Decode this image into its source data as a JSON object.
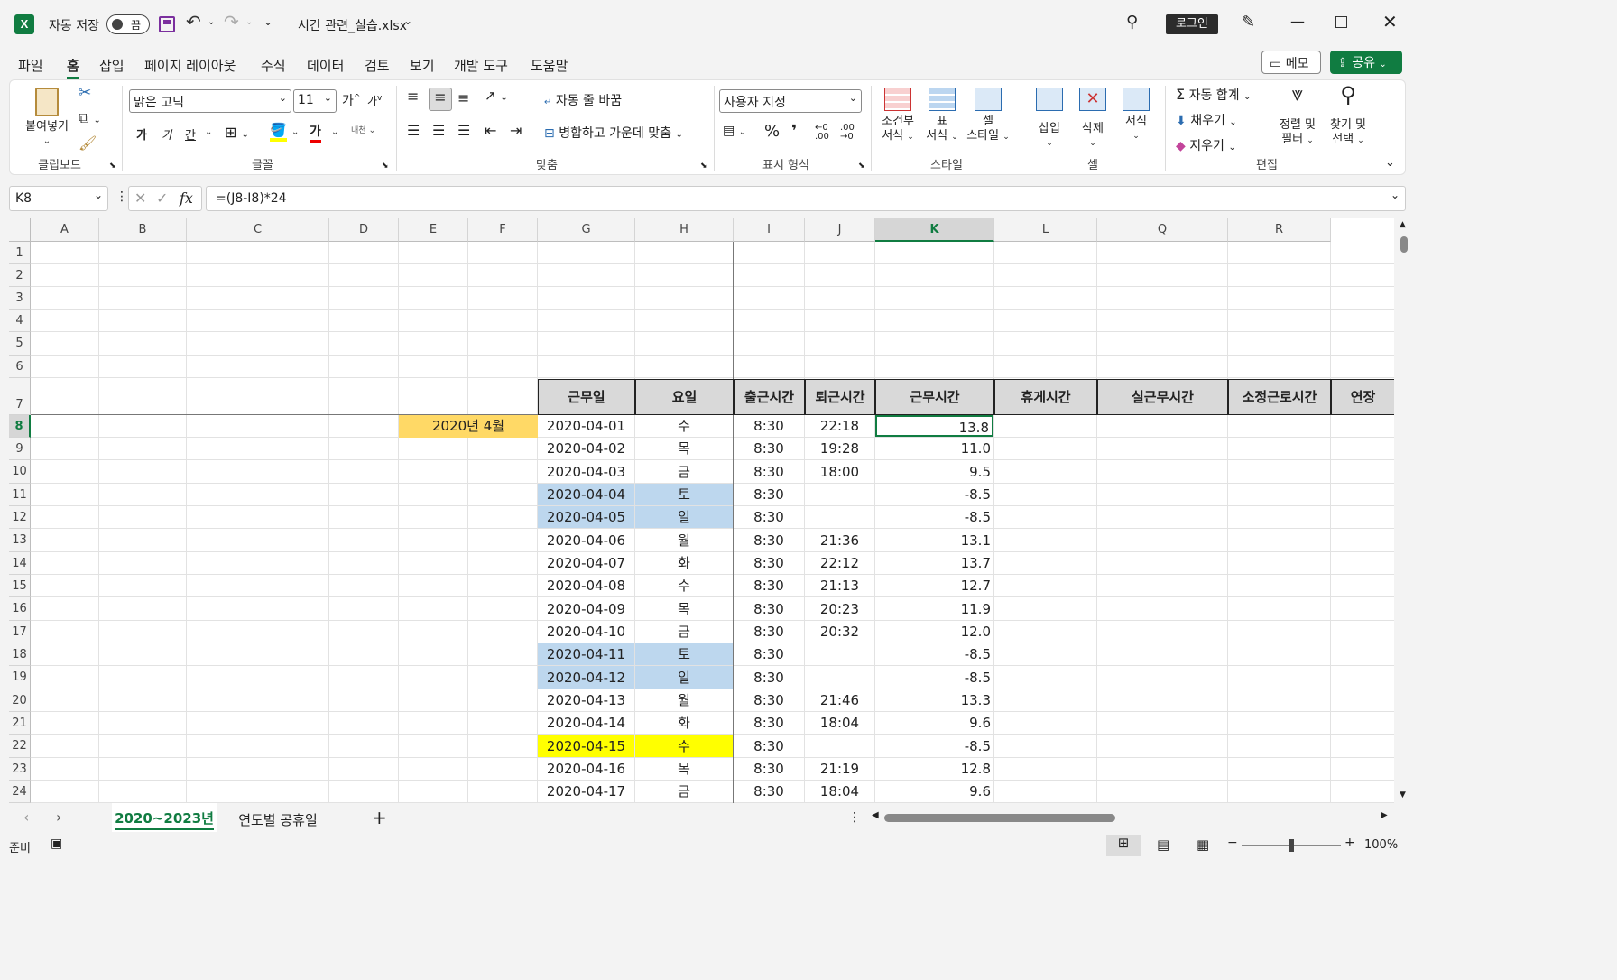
{
  "title": {
    "autosave_label": "자동 저장",
    "autosave_state": "끔",
    "filename": "시간 관련_실습.xlsx",
    "login_label": "로그인"
  },
  "menu": [
    "파일",
    "홈",
    "삽입",
    "페이지 레이아웃",
    "수식",
    "데이터",
    "검토",
    "보기",
    "개발 도구",
    "도움말"
  ],
  "menu_right": {
    "memo": "메모",
    "share": "공유"
  },
  "ribbon": {
    "clipboard": {
      "paste": "붙여넣기",
      "label": "클립보드"
    },
    "font": {
      "name": "맑은 고딕",
      "size": "11",
      "label": "글꼴",
      "bold": "가",
      "italic": "가",
      "underline": "간",
      "grow": "가",
      "shrink": "가"
    },
    "align": {
      "wrap": "자동 줄 바꿈",
      "merge": "병합하고 가운데 맞춤",
      "label": "맞춤"
    },
    "number": {
      "format": "사용자 지정",
      "label": "표시 형식",
      "percent": "%",
      "comma": "❜"
    },
    "styles": {
      "conditional": [
        "조건부",
        "서식"
      ],
      "table": [
        "표",
        "서식"
      ],
      "cell": [
        "셀",
        "스타일"
      ],
      "label": "스타일"
    },
    "cells": {
      "insert": "삽입",
      "delete": "삭제",
      "format": "서식",
      "label": "셀"
    },
    "edit": {
      "autosum": "자동 합계",
      "fill": "채우기",
      "clear": "지우기",
      "sort": [
        "정렬 및",
        "필터"
      ],
      "find": [
        "찾기 및",
        "선택"
      ],
      "label": "편집"
    }
  },
  "formula": {
    "namebox": "K8",
    "fx": "fx",
    "content": "=(J8-I8)*24"
  },
  "columns": [
    "A",
    "B",
    "C",
    "D",
    "E",
    "F",
    "G",
    "H",
    "I",
    "J",
    "K",
    "L",
    "Q",
    "R"
  ],
  "rows": [
    "1",
    "2",
    "3",
    "4",
    "5",
    "6",
    "7",
    "8",
    "9",
    "10",
    "11",
    "12",
    "13",
    "14",
    "15",
    "16",
    "17",
    "18",
    "19",
    "20",
    "21",
    "22",
    "23",
    "24"
  ],
  "table_headers": [
    "근무일",
    "요일",
    "출근시간",
    "퇴근시간",
    "근무시간",
    "휴게시간",
    "실근무시간",
    "소정근로시간",
    "연장"
  ],
  "month_label": "2020년 4월",
  "table_rows": [
    [
      "2020-04-01",
      "수",
      "8:30",
      "22:18",
      "13.8"
    ],
    [
      "2020-04-02",
      "목",
      "8:30",
      "19:28",
      "11.0"
    ],
    [
      "2020-04-03",
      "금",
      "8:30",
      "18:00",
      "9.5"
    ],
    [
      "2020-04-04",
      "토",
      "8:30",
      "",
      "-8.5"
    ],
    [
      "2020-04-05",
      "일",
      "8:30",
      "",
      "-8.5"
    ],
    [
      "2020-04-06",
      "월",
      "8:30",
      "21:36",
      "13.1"
    ],
    [
      "2020-04-07",
      "화",
      "8:30",
      "22:12",
      "13.7"
    ],
    [
      "2020-04-08",
      "수",
      "8:30",
      "21:13",
      "12.7"
    ],
    [
      "2020-04-09",
      "목",
      "8:30",
      "20:23",
      "11.9"
    ],
    [
      "2020-04-10",
      "금",
      "8:30",
      "20:32",
      "12.0"
    ],
    [
      "2020-04-11",
      "토",
      "8:30",
      "",
      "-8.5"
    ],
    [
      "2020-04-12",
      "일",
      "8:30",
      "",
      "-8.5"
    ],
    [
      "2020-04-13",
      "월",
      "8:30",
      "21:46",
      "13.3"
    ],
    [
      "2020-04-14",
      "화",
      "8:30",
      "18:04",
      "9.6"
    ],
    [
      "2020-04-15",
      "수",
      "8:30",
      "",
      "-8.5"
    ],
    [
      "2020-04-16",
      "목",
      "8:30",
      "21:19",
      "12.8"
    ],
    [
      "2020-04-17",
      "금",
      "8:30",
      "18:04",
      "9.6"
    ]
  ],
  "row_highlights": {
    "weekend": "#bdd7ee",
    "holiday": "#ffff00",
    "month": "#ffd966"
  },
  "weekend_rows": [
    3,
    4,
    10,
    11
  ],
  "holiday_rows": [
    14
  ],
  "sheets": {
    "active": "2020~2023년",
    "other": "연도별 공휴일",
    "add": "+"
  },
  "status": {
    "ready": "준비",
    "zoom": "100%"
  },
  "colors": {
    "accent": "#107c41",
    "grid": "#e2e2e2"
  }
}
